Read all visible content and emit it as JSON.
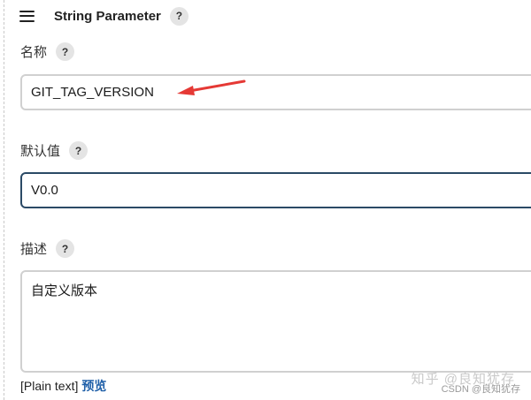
{
  "header": {
    "title": "String Parameter",
    "help": "?"
  },
  "name_field": {
    "label": "名称",
    "help": "?",
    "value": "GIT_TAG_VERSION"
  },
  "default_field": {
    "label": "默认值",
    "help": "?",
    "value": "V0.0"
  },
  "description_field": {
    "label": "描述",
    "help": "?",
    "value": "自定义版本"
  },
  "footer": {
    "format": "[Plain text]",
    "preview": "预览"
  },
  "watermark": {
    "main": "知乎 @良知犹存",
    "csdn": "CSDN @良知犹存"
  },
  "colors": {
    "link": "#1f5fa8",
    "arrow": "#e53935",
    "focus_border": "#2b4a66"
  }
}
